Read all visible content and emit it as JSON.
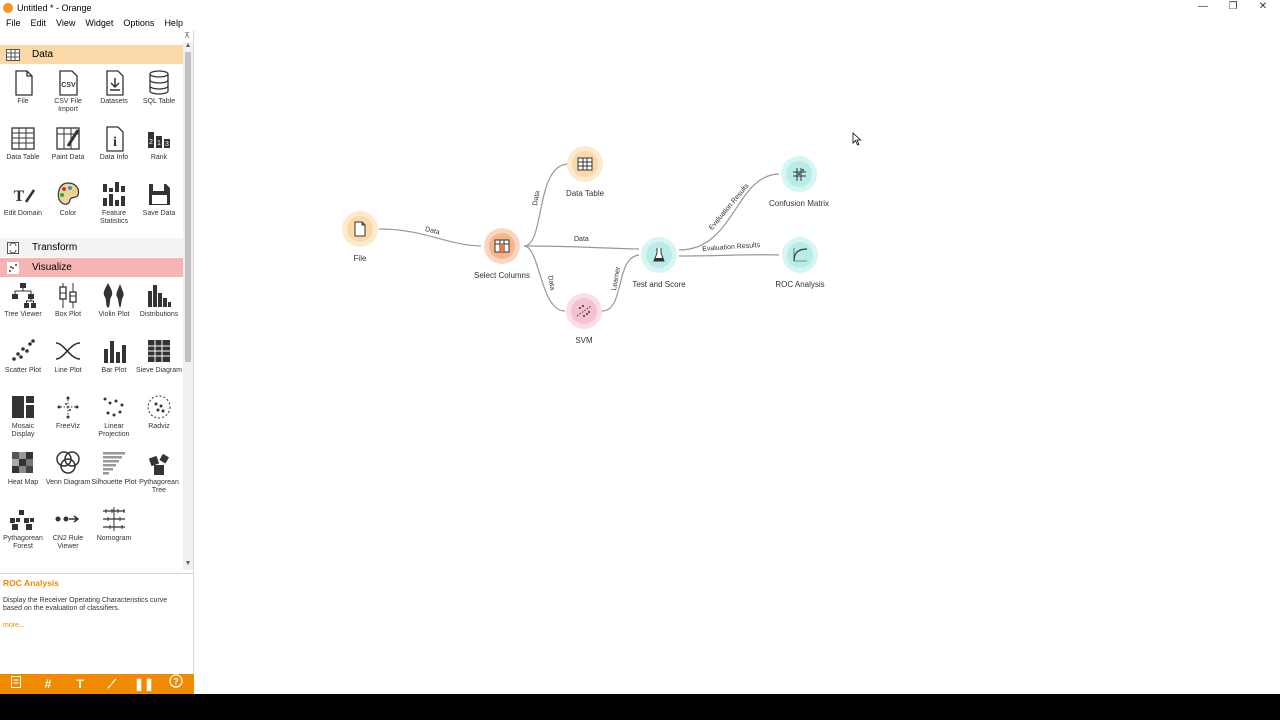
{
  "window": {
    "title": "Untitled * - Orange",
    "minimize": "—",
    "restore": "❐",
    "close": "✕"
  },
  "menu": [
    "File",
    "Edit",
    "View",
    "Widget",
    "Options",
    "Help"
  ],
  "categories": {
    "data": {
      "label": "Data",
      "color": "#fbd8a8",
      "icon_bg": "#f7a24a"
    },
    "transform": {
      "label": "Transform",
      "color": "#f3f3f3"
    },
    "visualize": {
      "label": "Visualize",
      "color": "#f8b4b4"
    }
  },
  "data_widgets": [
    {
      "name": "File",
      "icon": "file-icon"
    },
    {
      "name": "CSV File Import",
      "icon": "csv-icon"
    },
    {
      "name": "Datasets",
      "icon": "datasets-icon"
    },
    {
      "name": "SQL Table",
      "icon": "database-icon"
    },
    {
      "name": "Data Table",
      "icon": "table-icon"
    },
    {
      "name": "Paint Data",
      "icon": "paint-icon"
    },
    {
      "name": "Data Info",
      "icon": "info-icon"
    },
    {
      "name": "Rank",
      "icon": "rank-icon"
    },
    {
      "name": "Edit Domain",
      "icon": "edit-domain-icon"
    },
    {
      "name": "Color",
      "icon": "palette-icon"
    },
    {
      "name": "Feature Statistics",
      "icon": "feature-stats-icon"
    },
    {
      "name": "Save Data",
      "icon": "save-icon"
    }
  ],
  "visualize_widgets": [
    {
      "name": "Tree Viewer",
      "icon": "tree-icon"
    },
    {
      "name": "Box Plot",
      "icon": "boxplot-icon"
    },
    {
      "name": "Violin Plot",
      "icon": "violin-icon"
    },
    {
      "name": "Distributions",
      "icon": "distributions-icon"
    },
    {
      "name": "Scatter Plot",
      "icon": "scatter-icon"
    },
    {
      "name": "Line Plot",
      "icon": "lineplot-icon"
    },
    {
      "name": "Bar Plot",
      "icon": "barplot-icon"
    },
    {
      "name": "Sieve Diagram",
      "icon": "sieve-icon"
    },
    {
      "name": "Mosaic Display",
      "icon": "mosaic-icon"
    },
    {
      "name": "FreeViz",
      "icon": "freeviz-icon"
    },
    {
      "name": "Linear Projection",
      "icon": "linear-projection-icon"
    },
    {
      "name": "Radviz",
      "icon": "radviz-icon"
    },
    {
      "name": "Heat Map",
      "icon": "heatmap-icon"
    },
    {
      "name": "Venn Diagram",
      "icon": "venn-icon"
    },
    {
      "name": "Silhouette Plot",
      "icon": "silhouette-icon"
    },
    {
      "name": "Pythagorean Tree",
      "icon": "pythagorean-tree-icon"
    },
    {
      "name": "Pythagorean Forest",
      "icon": "pythagorean-forest-icon"
    },
    {
      "name": "CN2 Rule Viewer",
      "icon": "cn2-icon"
    },
    {
      "name": "Nomogram",
      "icon": "nomogram-icon"
    }
  ],
  "help": {
    "title": "ROC Analysis",
    "description": "Display the Receiver Operating Characteristics curve based on the evaluation of classifiers.",
    "more": "more..."
  },
  "workflow": {
    "nodes": [
      {
        "id": "file",
        "label": "File",
        "color": "#fbd8a8"
      },
      {
        "id": "select-columns",
        "label": "Select Columns",
        "color": "#f6b48a"
      },
      {
        "id": "data-table",
        "label": "Data Table",
        "color": "#fbd8a8"
      },
      {
        "id": "svm",
        "label": "SVM",
        "color": "#f6c2d0"
      },
      {
        "id": "test-and-score",
        "label": "Test and Score",
        "color": "#b7ece7"
      },
      {
        "id": "confusion-matrix",
        "label": "Confusion Matrix",
        "color": "#b7ece7"
      },
      {
        "id": "roc-analysis",
        "label": "ROC Analysis",
        "color": "#b7ece7"
      }
    ],
    "links": [
      {
        "from": "file",
        "to": "select-columns",
        "label": "Data"
      },
      {
        "from": "select-columns",
        "to": "data-table",
        "label": "Data"
      },
      {
        "from": "select-columns",
        "to": "test-and-score",
        "label": "Data"
      },
      {
        "from": "select-columns",
        "to": "svm",
        "label": "Data"
      },
      {
        "from": "svm",
        "to": "test-and-score",
        "label": "Learner"
      },
      {
        "from": "test-and-score",
        "to": "confusion-matrix",
        "label": "Evaluation Results"
      },
      {
        "from": "test-and-score",
        "to": "roc-analysis",
        "label": "Evaluation Results"
      }
    ]
  }
}
